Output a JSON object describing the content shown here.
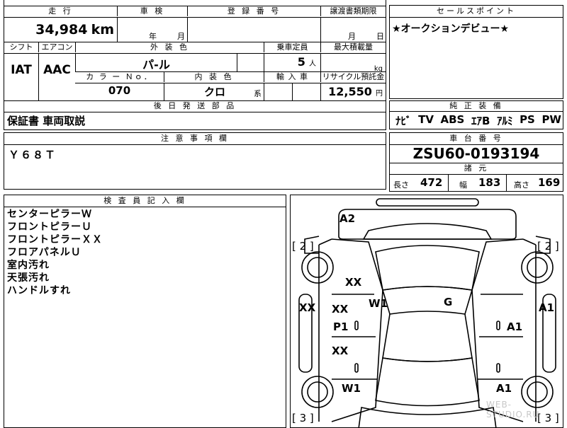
{
  "top_header": {
    "mileage": "走 行",
    "shaken": "車 検",
    "registration": "登 録 番 号",
    "transfer": "譲渡書類期限"
  },
  "mileage": {
    "value": "34,984",
    "unit": "km"
  },
  "shaken_units": {
    "year": "年",
    "month": "月"
  },
  "transfer_units": {
    "month": "月",
    "day": "日"
  },
  "row2_header": {
    "shift": "シフト",
    "aircon": "エアコン",
    "exterior": "外 装 色",
    "capacity": "乗車定員",
    "max_load": "最大積載量"
  },
  "shift": "IAT",
  "aircon": "AAC",
  "exterior_color": "パ-ル",
  "capacity": {
    "value": "5",
    "unit": "人"
  },
  "max_load_unit": "kg",
  "row3_header": {
    "color_no": "カ ラ ー Ｎｏ．",
    "interior": "内 装 色",
    "import": "輸 入 車",
    "recycle": "リサイクル預託金"
  },
  "color_no": "070",
  "interior_color": {
    "value": "クロ",
    "unit": "系"
  },
  "recycle": {
    "value": "12,550",
    "unit": "円"
  },
  "later_parts": {
    "header": "後 日 発 送 部 品",
    "value": "保証書 車両取説"
  },
  "notes": {
    "header": "注 意 事 項 欄",
    "value": "Ｙ６８Ｔ"
  },
  "sales_point": {
    "header": "セールスポイント",
    "value": "★オークションデビュー★"
  },
  "equipment": {
    "header": "純 正 装 備",
    "items": [
      "ﾅﾋﾞ",
      "TV",
      "ABS",
      "ｴｱB",
      "ｱﾙﾐ",
      "PS",
      "PW"
    ]
  },
  "chassis": {
    "header": "車 台 番 号",
    "value": "ZSU60-0193194"
  },
  "dimensions": {
    "header": "諸 元",
    "length_label": "長さ",
    "length": "472",
    "width_label": "幅",
    "width": "183",
    "height_label": "高さ",
    "height": "169"
  },
  "inspector": {
    "header": "検 査 員 記 入 欄",
    "lines": [
      "センターピラーＷ",
      "フロントピラーＵ",
      "フロントピラーＸＸ",
      "フロアパネルＵ",
      "室内汚れ",
      "天張汚れ",
      "ハンドルすれ"
    ]
  },
  "diagram": {
    "tire_labels": [
      "[ 2 ]",
      "[ 2 ]",
      "[ 3 ]",
      "[ 3 ]"
    ],
    "damage": [
      "A2",
      "XX",
      "W1",
      "G",
      "XX",
      "XX",
      "A1",
      "P1",
      "A1",
      "XX",
      "W1",
      "A1"
    ]
  },
  "watermark": "WEB-STUDIO.RU"
}
